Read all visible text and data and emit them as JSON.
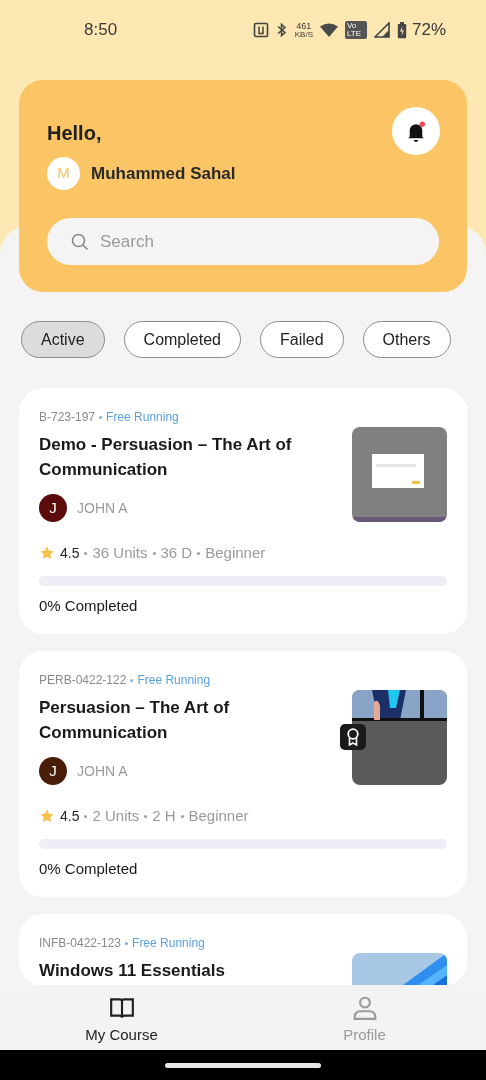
{
  "status_bar": {
    "time": "8:50",
    "network_speed": {
      "value": "461",
      "unit": "KB/S"
    },
    "volte": "Vo LTE",
    "battery": "72%"
  },
  "header": {
    "greeting": "Hello,",
    "user": {
      "initial": "M",
      "name": "Muhammed Sahal"
    },
    "notifications": {
      "unread": true
    },
    "search": {
      "placeholder": "Search"
    }
  },
  "filters": [
    {
      "label": "Active",
      "selected": true
    },
    {
      "label": "Completed",
      "selected": false
    },
    {
      "label": "Failed",
      "selected": false
    },
    {
      "label": "Others",
      "selected": false
    }
  ],
  "courses": [
    {
      "code": "B-723-197",
      "status": "Free Running",
      "title": "Demo - Persuasion – The Art of Communication",
      "thumbnail": {
        "kind": "picture"
      },
      "certificate": false,
      "instructor": {
        "initial": "J",
        "name": "JOHN A",
        "color": "#5c0a0a"
      },
      "rating": "4.5",
      "meta": [
        "36 Units",
        "36 D",
        "Beginner"
      ],
      "level": 0,
      "progress_text": "0% Completed"
    },
    {
      "code": "PERB-0422-122",
      "status": "Free Running",
      "title": "Persuasion – The Art of Communication",
      "thumbnail": {
        "kind": "picture"
      },
      "certificate": true,
      "instructor": {
        "initial": "J",
        "name": "JOHN A",
        "color": "#4a1d08"
      },
      "rating": "4.5",
      "meta": [
        "2 Units",
        "2 H",
        "Beginner"
      ],
      "level": 0,
      "progress_text": "0% Completed"
    },
    {
      "code": "INFB-0422-123",
      "status": "Free Running",
      "title": "Windows 11 Essentials",
      "thumbnail": {
        "kind": "picture"
      }
    }
  ],
  "bottom_nav": [
    {
      "label": "My Course",
      "selected": true
    },
    {
      "label": "Profile",
      "selected": false
    }
  ]
}
